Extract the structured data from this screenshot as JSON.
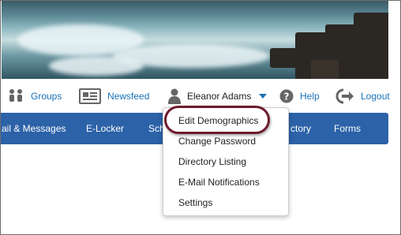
{
  "links": {
    "groups": "Groups",
    "newsfeed": "Newsfeed",
    "user_name": "Eleanor Adams",
    "help": "Help",
    "logout": "Logout"
  },
  "nav": {
    "items": [
      "ail & Messages",
      "E-Locker",
      "Sch",
      "ctory",
      "Forms"
    ]
  },
  "dropdown": {
    "items": [
      "Edit Demographics",
      "Change Password",
      "Directory Listing",
      "E-Mail Notifications",
      "Settings"
    ]
  },
  "icons": {
    "groups": "groups-icon",
    "newsfeed": "newspaper-icon",
    "user": "user-icon",
    "help": "help-icon",
    "logout": "logout-icon",
    "dropdown": "caret-down-icon"
  },
  "colors": {
    "link": "#1a73b8",
    "nav_bg": "#2c62a8",
    "highlight_ring": "#6e1b2c"
  }
}
